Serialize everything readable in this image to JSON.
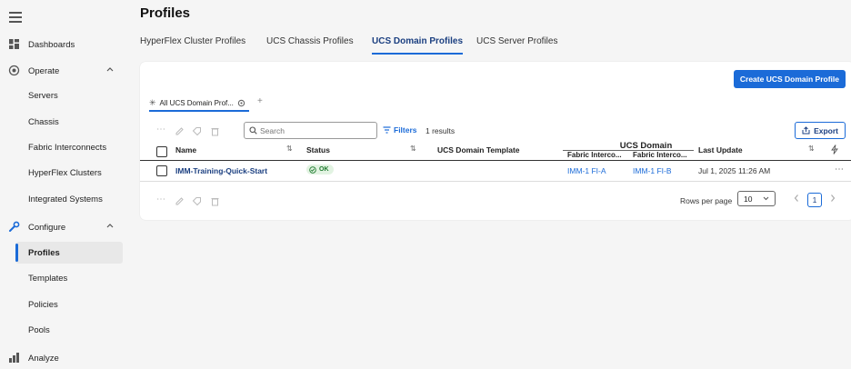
{
  "sidebar": {
    "items": [
      {
        "label": "Dashboards"
      },
      {
        "label": "Operate"
      },
      {
        "label": "Servers"
      },
      {
        "label": "Chassis"
      },
      {
        "label": "Fabric Interconnects"
      },
      {
        "label": "HyperFlex Clusters"
      },
      {
        "label": "Integrated Systems"
      },
      {
        "label": "Configure"
      },
      {
        "label": "Profiles"
      },
      {
        "label": "Templates"
      },
      {
        "label": "Policies"
      },
      {
        "label": "Pools"
      },
      {
        "label": "Analyze"
      }
    ]
  },
  "page": {
    "title": "Profiles"
  },
  "tabs": [
    {
      "label": "HyperFlex Cluster Profiles"
    },
    {
      "label": "UCS Chassis Profiles"
    },
    {
      "label": "UCS Domain Profiles"
    },
    {
      "label": "UCS Server Profiles"
    }
  ],
  "actions": {
    "create_label": "Create UCS Domain Profile",
    "export_label": "Export"
  },
  "view": {
    "tab_label": "All UCS Domain Prof...",
    "add_symbol": "+"
  },
  "toolbar": {
    "search_placeholder": "Search",
    "filters_label": "Filters",
    "results": "1 results"
  },
  "table": {
    "headers": {
      "name": "Name",
      "status": "Status",
      "template": "UCS Domain Template",
      "group": "UCS Domain",
      "fi_a": "Fabric Interco...",
      "fi_b": "Fabric Interco...",
      "last_update": "Last Update"
    },
    "rows": [
      {
        "name": "IMM-Training-Quick-Start",
        "status": "OK",
        "template": "",
        "fi_a": "IMM-1 FI-A",
        "fi_b": "IMM-1 FI-B",
        "last_update": "Jul 1, 2025 11:26 AM"
      }
    ]
  },
  "pagination": {
    "rows_per_page_label": "Rows per page",
    "rows_per_page": "10",
    "page": "1"
  },
  "colors": {
    "accent": "#1b6bd8",
    "link": "#1b3f80",
    "ok_bg": "#e2f3e2",
    "ok_fg": "#1e7a2e"
  }
}
